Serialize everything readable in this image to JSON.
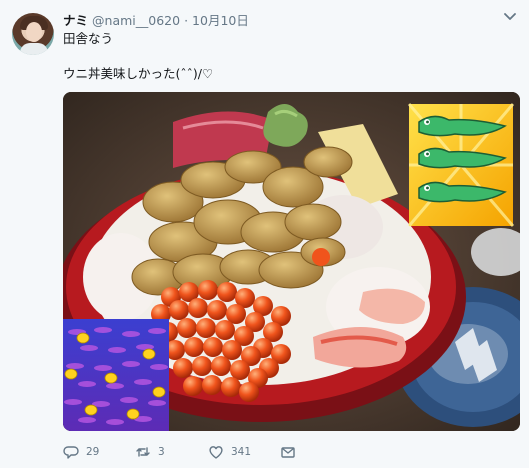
{
  "tweet": {
    "display_name": "ナミ",
    "handle": "@nami__0620",
    "separator": "·",
    "date": "10月10日",
    "text_line1": "田舎なう",
    "text_line2": "ウニ丼美味しかった(ˆˆ)/♡",
    "image_icon": "photo-uni-don-bowl",
    "sticker_icons": [
      "green-salamander-sticker",
      "yellow-fish-school-sticker"
    ]
  },
  "actions": {
    "reply_count": "29",
    "retweet_count": "3",
    "like_count": "341",
    "reply_icon": "reply-icon",
    "retweet_icon": "retweet-icon",
    "like_icon": "heart-icon",
    "dm_icon": "envelope-icon"
  },
  "colors": {
    "icon_gray": "#657786",
    "background": "#f5f8fa"
  }
}
